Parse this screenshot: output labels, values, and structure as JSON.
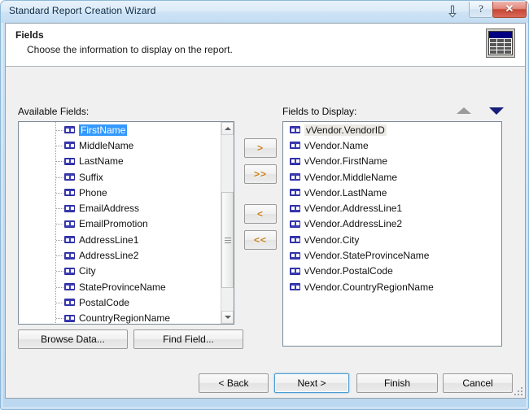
{
  "window": {
    "title": "Standard Report Creation Wizard",
    "help_label": "?",
    "close_label": "✕",
    "pin_icon": "collapse-arrow-icon"
  },
  "banner": {
    "title": "Fields",
    "subtitle": "Choose the information to display on the report.",
    "icon": "table-grid-icon"
  },
  "available": {
    "label": "Available Fields:",
    "items": [
      {
        "label": "FirstName",
        "selected": true
      },
      {
        "label": "MiddleName",
        "selected": false
      },
      {
        "label": "LastName",
        "selected": false
      },
      {
        "label": "Suffix",
        "selected": false
      },
      {
        "label": "Phone",
        "selected": false
      },
      {
        "label": "EmailAddress",
        "selected": false
      },
      {
        "label": "EmailPromotion",
        "selected": false
      },
      {
        "label": "AddressLine1",
        "selected": false
      },
      {
        "label": "AddressLine2",
        "selected": false
      },
      {
        "label": "City",
        "selected": false
      },
      {
        "label": "StateProvinceName",
        "selected": false
      },
      {
        "label": "PostalCode",
        "selected": false
      },
      {
        "label": "CountryRegionName",
        "selected": false
      }
    ]
  },
  "display": {
    "label": "Fields to Display:",
    "items": [
      {
        "label": "vVendor.VendorID",
        "softsel": true
      },
      {
        "label": "vVendor.Name",
        "softsel": false
      },
      {
        "label": "vVendor.FirstName",
        "softsel": false
      },
      {
        "label": "vVendor.MiddleName",
        "softsel": false
      },
      {
        "label": "vVendor.LastName",
        "softsel": false
      },
      {
        "label": "vVendor.AddressLine1",
        "softsel": false
      },
      {
        "label": "vVendor.AddressLine2",
        "softsel": false
      },
      {
        "label": "vVendor.City",
        "softsel": false
      },
      {
        "label": "vVendor.StateProvinceName",
        "softsel": false
      },
      {
        "label": "vVendor.PostalCode",
        "softsel": false
      },
      {
        "label": "vVendor.CountryRegionName",
        "softsel": false
      }
    ],
    "sort_up_icon": "sort-up-arrow-icon",
    "sort_down_icon": "sort-down-arrow-icon",
    "sort_up_state": "disabled",
    "sort_down_state": "enabled"
  },
  "transfer": {
    "add": ">",
    "add_all": ">>",
    "remove": "<",
    "remove_all": "<<"
  },
  "tools": {
    "browse_data": "Browse Data...",
    "find_field": "Find Field..."
  },
  "navigation": {
    "back": "< Back",
    "next": "Next >",
    "finish": "Finish",
    "cancel": "Cancel",
    "default_button": "Next >"
  },
  "colors": {
    "selection_blue": "#3399ff",
    "close_red": "#c64733",
    "accent_navy": "#000080",
    "arrow_amber": "#c87d12",
    "frame_blue": "#bcd8f0"
  }
}
